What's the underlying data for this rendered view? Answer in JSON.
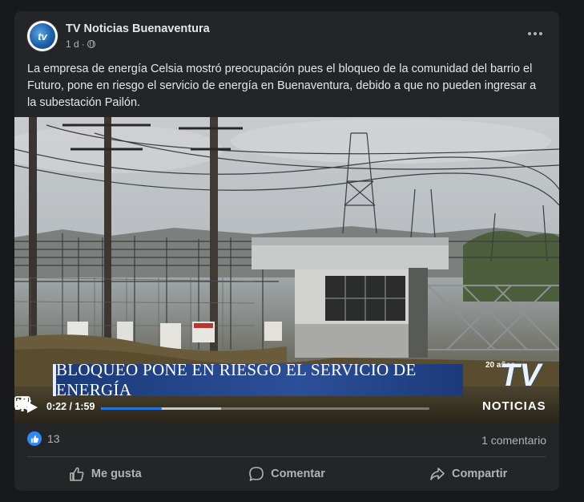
{
  "post": {
    "page_name": "TV Noticias Buenaventura",
    "time": "1 d",
    "separator": "·",
    "text": "La empresa de energía Celsia mostró preocupación pues el bloqueo de la comunidad del barrio el Futuro, pone en riesgo el servicio de energía en Buenaventura, debido a que no pueden ingresar a la subestación Pailón."
  },
  "video": {
    "banner": "BLOQUEO PONE EN RIESGO EL SERVICIO DE ENERGÍA",
    "logo_main": "TV",
    "logo_years": "20 años",
    "logo_sub": "NOTICIAS",
    "time": "0:22 / 1:59",
    "progress_fraction": 0.185
  },
  "stats": {
    "likes": "13",
    "comments": "1 comentario"
  },
  "actions": {
    "like": "Me gusta",
    "comment": "Comentar",
    "share": "Compartir"
  },
  "colors": {
    "accent": "#2374e1",
    "banner": "#2c4f99"
  },
  "icons": [
    "globe-icon",
    "more-icon",
    "play-icon",
    "settings-icon",
    "fullscreen-icon",
    "pip-icon",
    "volume-muted-icon",
    "like-icon",
    "comment-icon",
    "share-icon"
  ]
}
